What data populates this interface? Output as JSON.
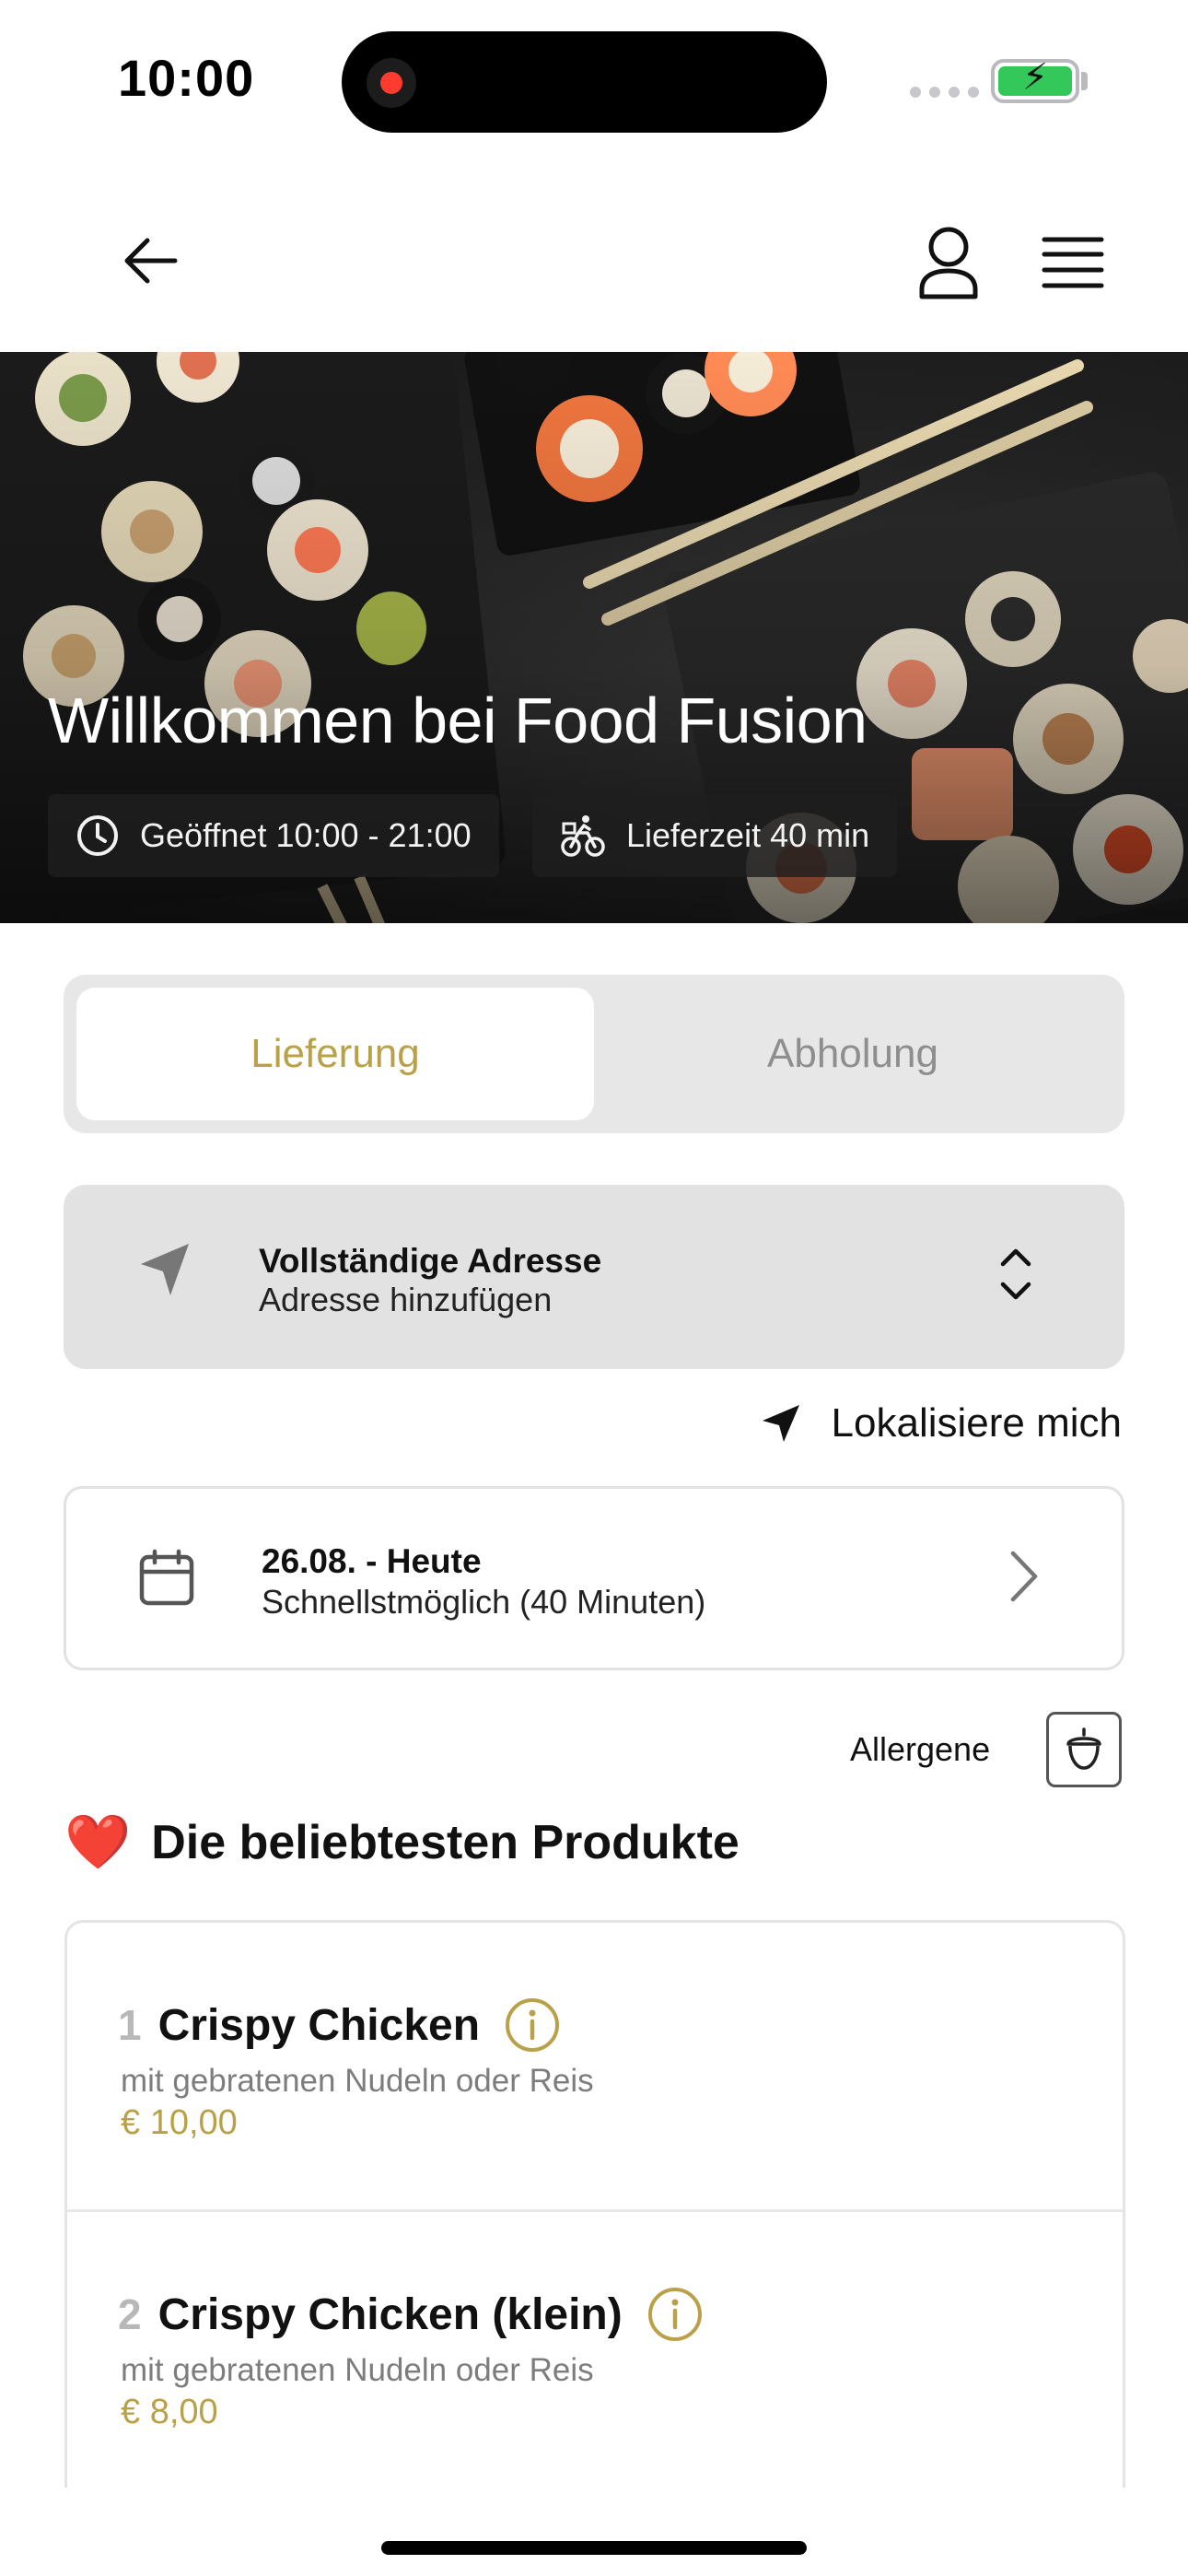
{
  "status_bar": {
    "time": "10:00"
  },
  "icons": {
    "back": "arrow-left-icon",
    "profile": "user-icon",
    "menu": "hamburger-menu-icon",
    "clock": "clock-icon",
    "delivery": "bicycle-courier-icon",
    "location": "navigation-arrow-icon",
    "chevrons": "chevron-up-down-icon",
    "calendar": "calendar-icon",
    "chevron_right": "chevron-right-icon",
    "allergen": "acorn-icon",
    "info": "info-circle-icon"
  },
  "hero": {
    "title": "Willkommen bei Food Fusion",
    "opening_hours": "Geöffnet 10:00 - 21:00",
    "delivery_time": "Lieferzeit 40 min"
  },
  "mode_tabs": [
    {
      "label": "Lieferung",
      "active": true
    },
    {
      "label": "Abholung",
      "active": false
    }
  ],
  "address": {
    "title": "Vollständige Adresse",
    "subtitle": "Adresse hinzufügen",
    "locate_label": "Lokalisiere mich"
  },
  "schedule": {
    "date": "26.08. - Heute",
    "time": "Schnellstmöglich (40 Minuten)"
  },
  "allergen_label": "Allergene",
  "section": {
    "emoji": "❤️",
    "title": "Die beliebtesten Produkte"
  },
  "products": [
    {
      "number": "1",
      "name": "Crispy Chicken",
      "description": "mit gebratenen Nudeln oder Reis",
      "price": "€ 10,00"
    },
    {
      "number": "2",
      "name": "Crispy Chicken (klein)",
      "description": "mit gebratenen Nudeln oder Reis",
      "price": "€ 8,00"
    }
  ],
  "colors": {
    "accent": "#b9a14a",
    "battery": "#34c759"
  }
}
